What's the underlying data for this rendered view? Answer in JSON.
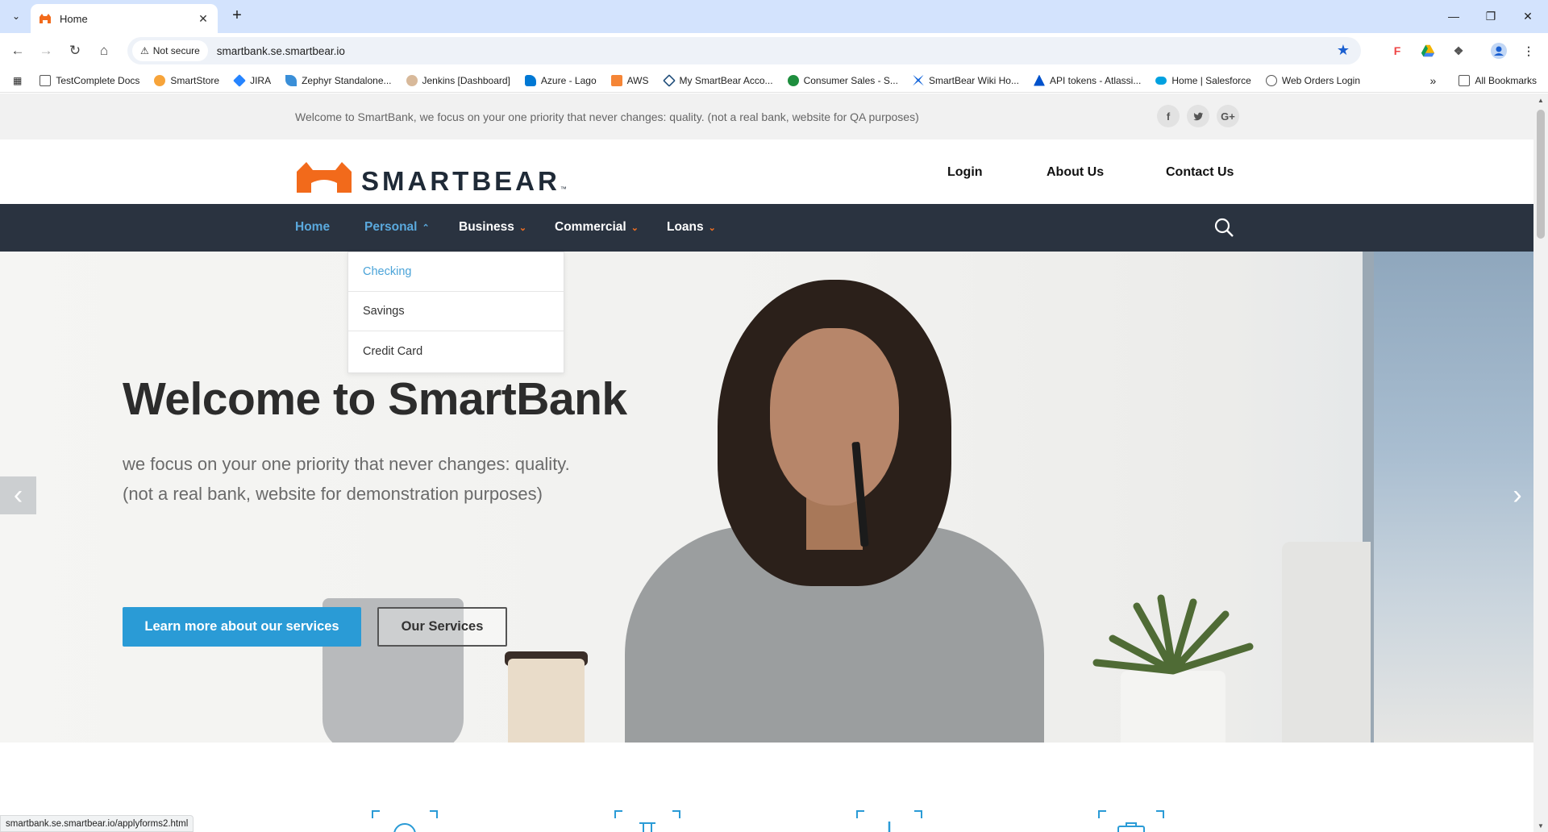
{
  "browser": {
    "tab_title": "Home",
    "new_tab_symbol": "+",
    "security_label": "Not secure",
    "url": "smartbank.se.smartbear.io",
    "status_url": "smartbank.se.smartbear.io/applyforms2.html",
    "bookmarks": [
      {
        "label": "TestComplete Docs",
        "icon": "folder-icon"
      },
      {
        "label": "SmartStore",
        "icon": "smartstore-icon"
      },
      {
        "label": "JIRA",
        "icon": "jira-icon"
      },
      {
        "label": "Zephyr Standalone...",
        "icon": "zephyr-icon"
      },
      {
        "label": "Jenkins [Dashboard]",
        "icon": "jenkins-icon"
      },
      {
        "label": "Azure - Lago",
        "icon": "azure-icon"
      },
      {
        "label": "AWS",
        "icon": "aws-icon"
      },
      {
        "label": "My SmartBear Acco...",
        "icon": "smartbear-icon"
      },
      {
        "label": "Consumer Sales - S...",
        "icon": "sheet-icon"
      },
      {
        "label": "SmartBear Wiki Ho...",
        "icon": "confluence-icon"
      },
      {
        "label": "API tokens - Atlassi...",
        "icon": "atlassian-icon"
      },
      {
        "label": "Home | Salesforce",
        "icon": "salesforce-icon"
      },
      {
        "label": "Web Orders Login",
        "icon": "globe-icon"
      }
    ],
    "all_bookmarks_label": "All Bookmarks",
    "colors": {
      "tabstrip": "#d3e3fd",
      "star": "#1a5fd0"
    }
  },
  "site": {
    "topbar_text": "Welcome to SmartBank, we focus on your one priority that never changes: quality. (not a real bank, website for QA purposes)",
    "social": [
      {
        "name": "facebook-icon",
        "glyph": "f"
      },
      {
        "name": "twitter-icon",
        "glyph": "t"
      },
      {
        "name": "google-plus-icon",
        "glyph": "G+"
      }
    ],
    "logo_text": "SMARTBEAR",
    "logo_tm": "™",
    "header_links": [
      "Login",
      "About Us",
      "Contact Us"
    ],
    "nav": [
      {
        "label": "Home",
        "active": true
      },
      {
        "label": "Personal",
        "open": true
      },
      {
        "label": "Business"
      },
      {
        "label": "Commercial"
      },
      {
        "label": "Loans"
      }
    ],
    "personal_dropdown": [
      "Checking",
      "Savings",
      "Credit Card"
    ],
    "hero": {
      "title": "Welcome to SmartBank",
      "subtitle_line1": "we focus on your one priority that never changes: quality.",
      "subtitle_line2": "(not a real bank, website for demonstration purposes)",
      "primary_button": "Learn more about our services",
      "secondary_button": "Our Services"
    },
    "colors": {
      "nav_bg": "#2a3340",
      "accent_blue": "#2a9bd6",
      "chevron_orange": "#f37021",
      "logo_orange": "#f26a1b"
    }
  }
}
